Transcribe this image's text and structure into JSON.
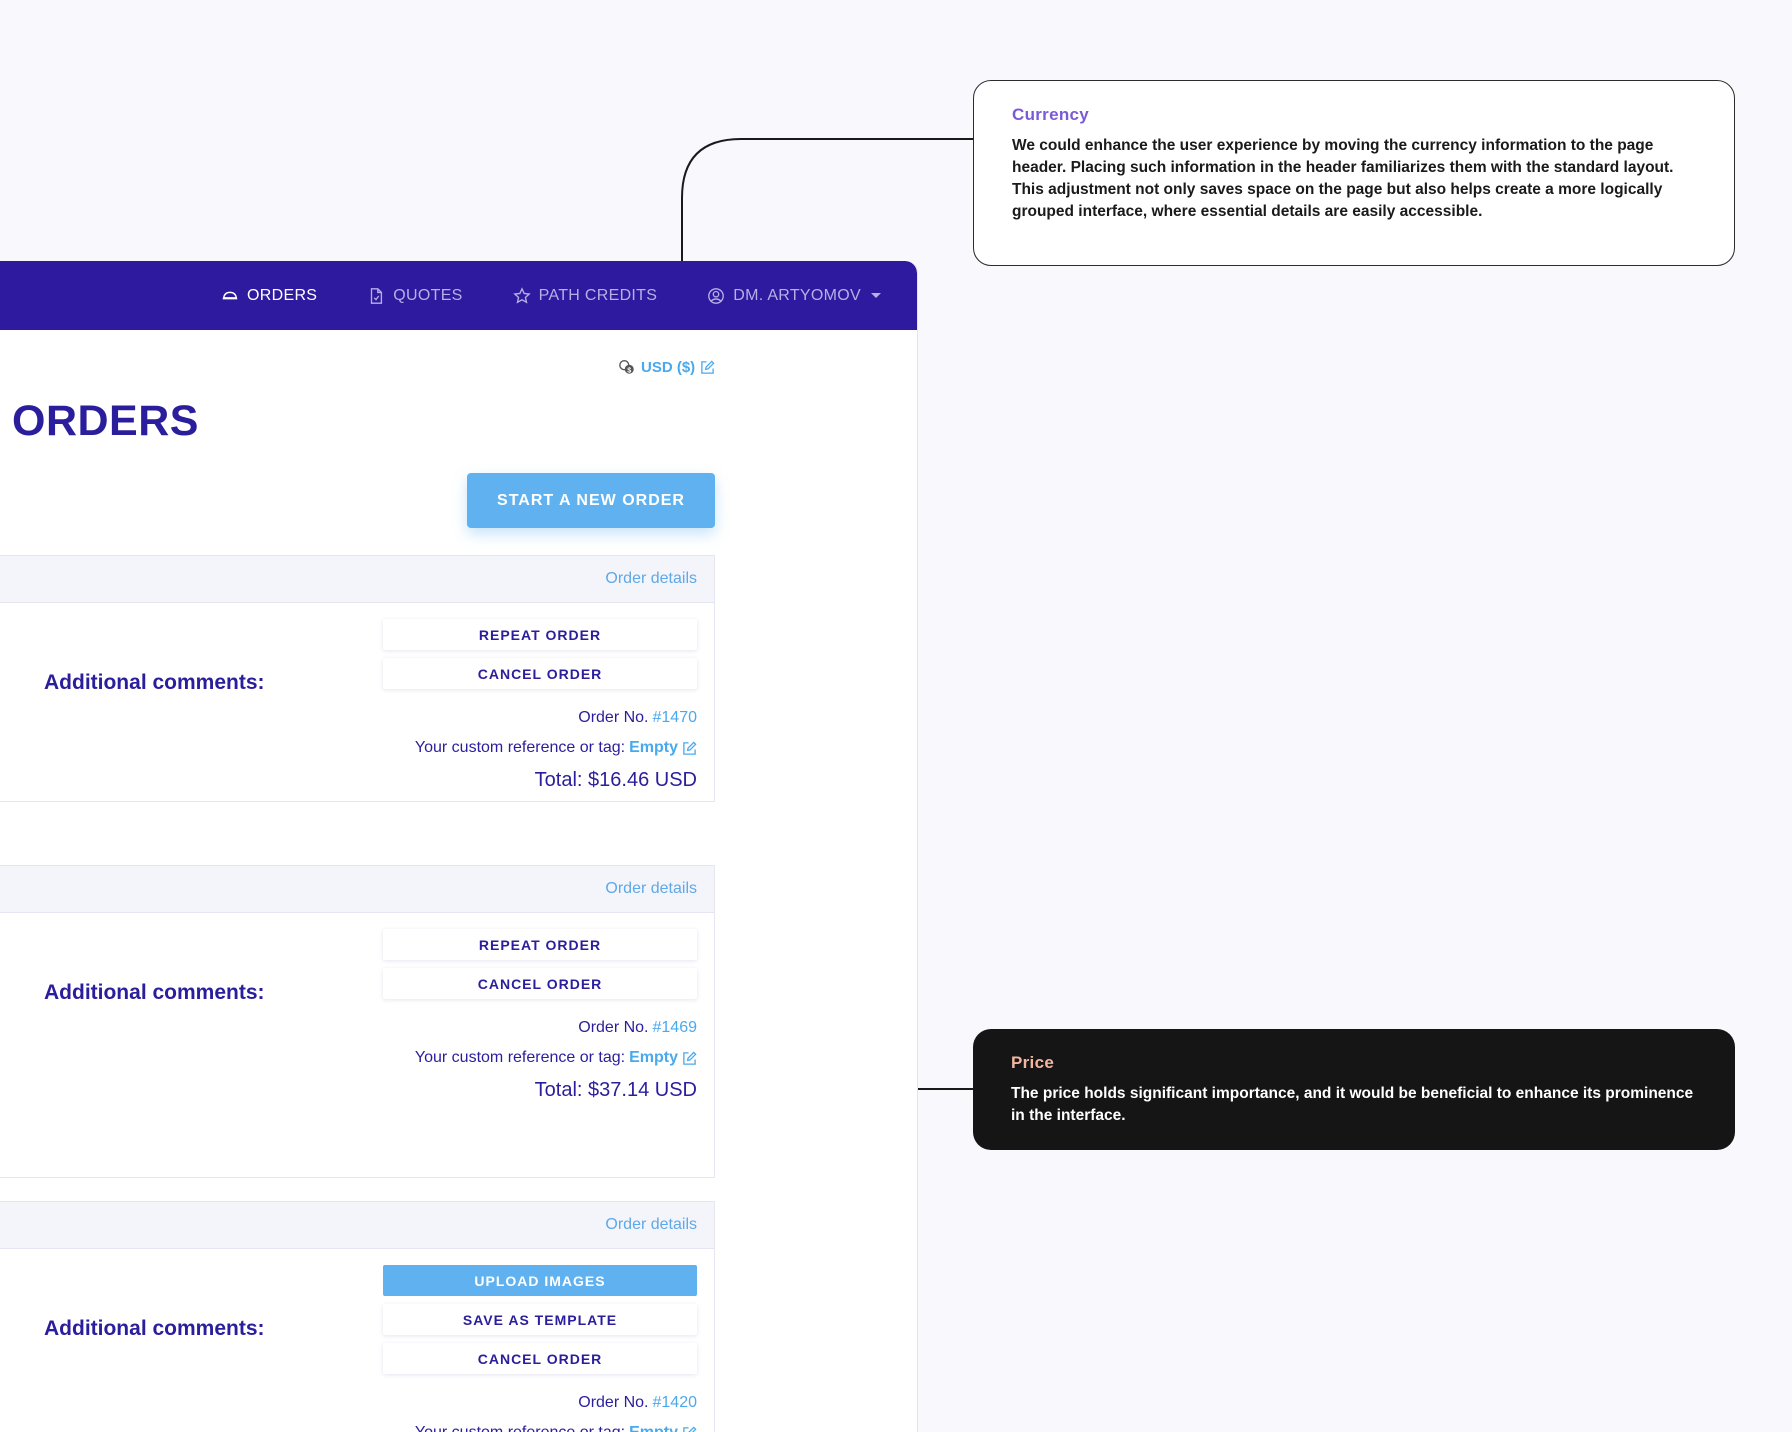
{
  "nav": {
    "items": [
      {
        "label": "ORDERS",
        "icon": "cart-icon",
        "active": true
      },
      {
        "label": "QUOTES",
        "icon": "document-icon",
        "active": false
      },
      {
        "label": "PATH CREDITS",
        "icon": "star-icon",
        "active": false
      },
      {
        "label": "DM. ARTYOMOV",
        "icon": "user-circle-icon",
        "active": false
      }
    ]
  },
  "currency": {
    "label": "USD ($)"
  },
  "page": {
    "title": "ORDERS",
    "new_order_label": "START A NEW ORDER"
  },
  "orders": [
    {
      "details_label": "Order details",
      "comments_label": "Additional comments:",
      "actions": [
        "REPEAT ORDER",
        "CANCEL ORDER"
      ],
      "order_no_label": "Order No.",
      "order_no": "#1470",
      "tag_label": "Your custom reference or tag:",
      "tag_value": "Empty",
      "total": "Total: $16.46 USD"
    },
    {
      "details_label": "Order details",
      "comments_label": "Additional comments:",
      "actions": [
        "REPEAT ORDER",
        "CANCEL ORDER"
      ],
      "order_no_label": "Order No.",
      "order_no": "#1469",
      "tag_label": "Your custom reference or tag:",
      "tag_value": "Empty",
      "total": "Total: $37.14 USD"
    },
    {
      "details_label": "Order details",
      "comments_label": "Additional comments:",
      "actions": [
        "UPLOAD IMAGES",
        "SAVE AS TEMPLATE",
        "CANCEL ORDER"
      ],
      "order_no_label": "Order No.",
      "order_no": "#1420",
      "tag_label": "Your custom reference or tag:",
      "tag_value": "Empty"
    }
  ],
  "annotations": {
    "currency": {
      "title": "Currency",
      "body": "We could enhance the user experience by moving the currency information to the page header. Placing such information in the header familiarizes them with the standard layout. This adjustment not only saves space on the page but also helps create a more logically grouped interface, where essential details are easily accessible."
    },
    "price": {
      "title": "Price",
      "body": "The price holds significant importance, and it would be beneficial to enhance its prominence in the interface."
    }
  },
  "colors": {
    "navbar": "#2d1a9e",
    "primary_text": "#2a1e9c",
    "accent_blue": "#5fb2ef",
    "link_blue": "#4aa9ec",
    "annotation_currency_title": "#7b5ad8",
    "annotation_price_title": "#f2b6a0"
  }
}
